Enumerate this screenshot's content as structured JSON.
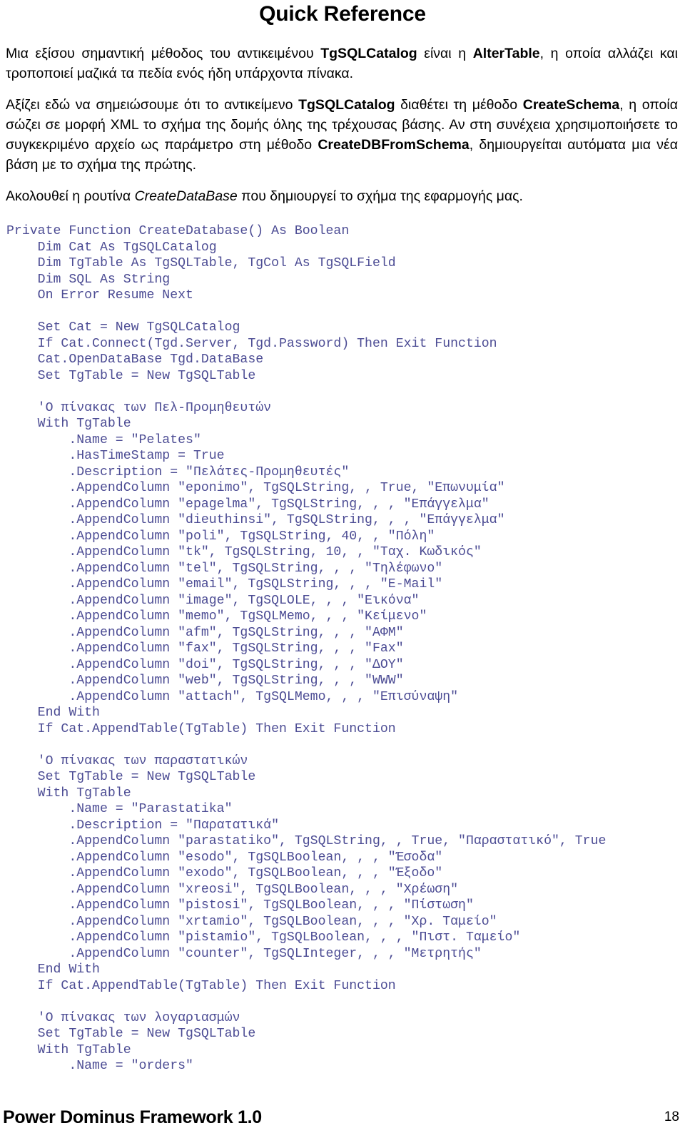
{
  "document": {
    "title": "Quick Reference",
    "footer": {
      "framework": "Power Dominus Framework 1.0",
      "page_number": "18"
    }
  },
  "paragraphs": {
    "p1": {
      "s1": "Μια εξίσου σημαντική μέθοδος του αντικειμένου ",
      "b1": "TgSQLCatalog",
      "s2": " είναι η ",
      "b2": "AlterTable",
      "s3": ", η οποία αλλάζει και τροποποιεί μαζικά τα πεδία ενός ήδη υπάρχοντα πίνακα."
    },
    "p2": {
      "s1": "Αξίζει εδώ να σημειώσουμε ότι το αντικείμενο ",
      "b1": "TgSQLCatalog",
      "s2": " διαθέτει τη μέθοδο ",
      "b2": "CreateSchema",
      "s3": ", η οποία σώζει σε μορφή XML το σχήμα της δομής όλης της τρέχουσας βάσης. Αν στη συνέχεια χρησιμοποιήσετε το συγκεκριμένο αρχείο ως παράμετρο στη μέθοδο ",
      "b3": "CreateDBFromSchema",
      "s4": ", δημιουργείται αυτόματα μια νέα βάση με το σχήμα της πρώτης."
    },
    "p3": {
      "s1": "Ακολουθεί η ρουτίνα ",
      "i1": "CreateDataBase",
      "s2": " που δημιουργεί το σχήμα της εφαρμογής μας."
    }
  },
  "code": {
    "language": "VB",
    "color": "#4c4c94",
    "lines": [
      "Private Function CreateDatabase() As Boolean",
      "    Dim Cat As TgSQLCatalog",
      "    Dim TgTable As TgSQLTable, TgCol As TgSQLField",
      "    Dim SQL As String",
      "    On Error Resume Next",
      "",
      "    Set Cat = New TgSQLCatalog",
      "    If Cat.Connect(Tgd.Server, Tgd.Password) Then Exit Function",
      "    Cat.OpenDataBase Tgd.DataBase",
      "    Set TgTable = New TgSQLTable",
      "",
      "    'Ο πίνακας των Πελ-Προμηθευτών",
      "    With TgTable",
      "        .Name = \"Pelates\"",
      "        .HasTimeStamp = True",
      "        .Description = \"Πελάτες-Προμηθευτές\"",
      "        .AppendColumn \"eponimo\", TgSQLString, , True, \"Επωνυμία\"",
      "        .AppendColumn \"epagelma\", TgSQLString, , , \"Επάγγελμα\"",
      "        .AppendColumn \"dieuthinsi\", TgSQLString, , , \"Επάγγελμα\"",
      "        .AppendColumn \"poli\", TgSQLString, 40, , \"Πόλη\"",
      "        .AppendColumn \"tk\", TgSQLString, 10, , \"Ταχ. Κωδικός\"",
      "        .AppendColumn \"tel\", TgSQLString, , , \"Τηλέφωνο\"",
      "        .AppendColumn \"email\", TgSQLString, , , \"E-Mail\"",
      "        .AppendColumn \"image\", TgSQLOLE, , , \"Εικόνα\"",
      "        .AppendColumn \"memo\", TgSQLMemo, , , \"Κείμενο\"",
      "        .AppendColumn \"afm\", TgSQLString, , , \"ΑΦΜ\"",
      "        .AppendColumn \"fax\", TgSQLString, , , \"Fax\"",
      "        .AppendColumn \"doi\", TgSQLString, , , \"ΔΟΥ\"",
      "        .AppendColumn \"web\", TgSQLString, , , \"WWW\"",
      "        .AppendColumn \"attach\", TgSQLMemo, , , \"Επισύναψη\"",
      "    End With",
      "    If Cat.AppendTable(TgTable) Then Exit Function",
      "",
      "    'Ο πίνακας των παραστατικών",
      "    Set TgTable = New TgSQLTable",
      "    With TgTable",
      "        .Name = \"Parastatika\"",
      "        .Description = \"Παρατατικά\"",
      "        .AppendColumn \"parastatiko\", TgSQLString, , True, \"Παραστατικό\", True",
      "        .AppendColumn \"esodo\", TgSQLBoolean, , , \"Έσοδα\"",
      "        .AppendColumn \"exodo\", TgSQLBoolean, , , \"Έξοδο\"",
      "        .AppendColumn \"xreosi\", TgSQLBoolean, , , \"Χρέωση\"",
      "        .AppendColumn \"pistosi\", TgSQLBoolean, , , \"Πίστωση\"",
      "        .AppendColumn \"xrtamio\", TgSQLBoolean, , , \"Χρ. Ταμείο\"",
      "        .AppendColumn \"pistamio\", TgSQLBoolean, , , \"Πιστ. Ταμείο\"",
      "        .AppendColumn \"counter\", TgSQLInteger, , , \"Μετρητής\"",
      "    End With",
      "    If Cat.AppendTable(TgTable) Then Exit Function",
      "",
      "    'Ο πίνακας των λογαριασμών",
      "    Set TgTable = New TgSQLTable",
      "    With TgTable",
      "        .Name = \"orders\""
    ]
  }
}
